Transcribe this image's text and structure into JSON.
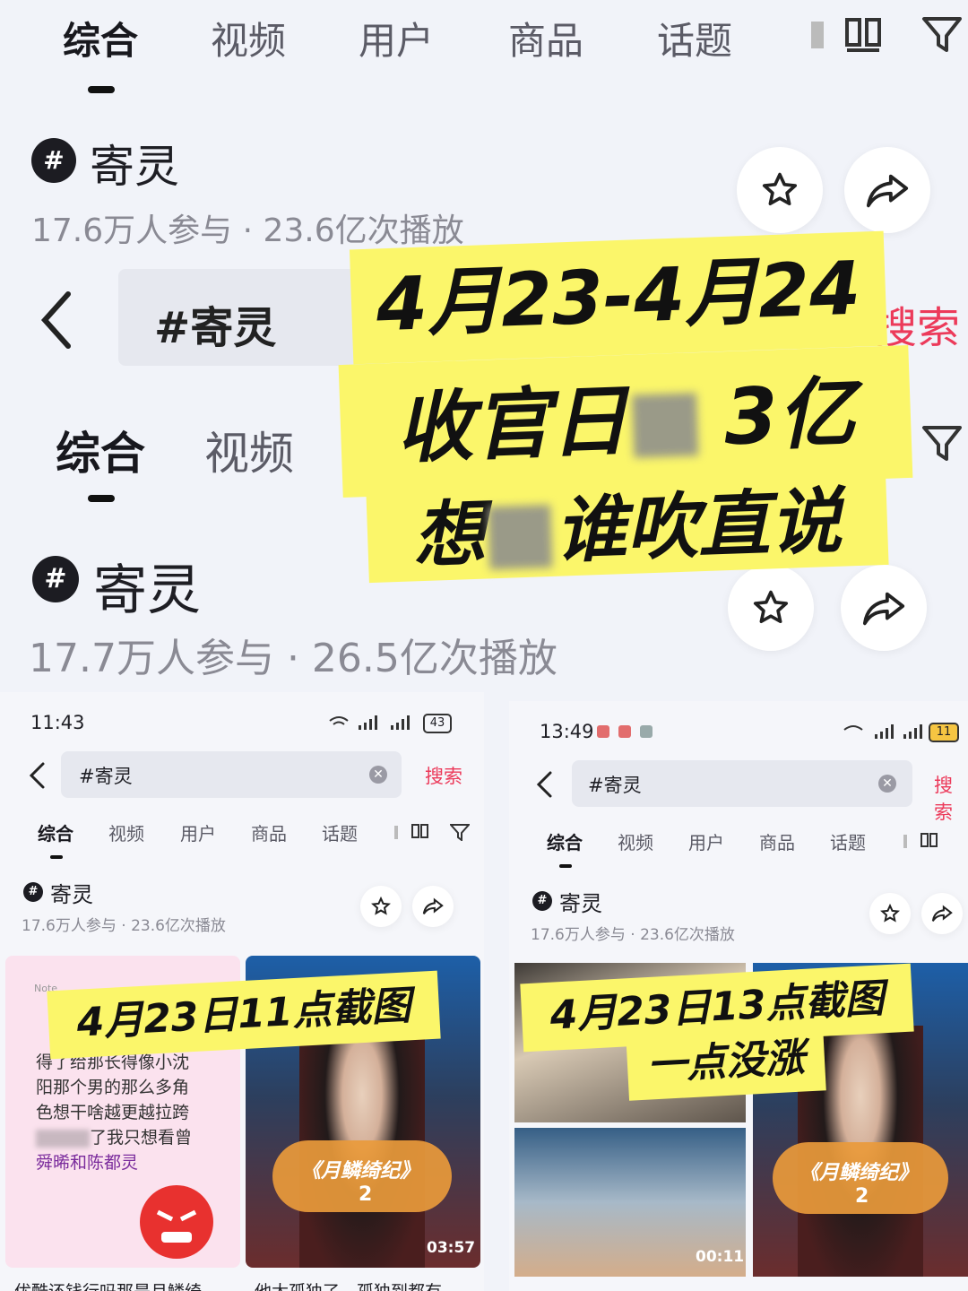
{
  "top": {
    "tabs": [
      "综合",
      "视频",
      "用户",
      "商品",
      "话题"
    ],
    "topic_title": "寄灵",
    "stats": "17.6万人参与 · 23.6亿次播放"
  },
  "search": {
    "query": "#寄灵",
    "button": "搜索"
  },
  "middle": {
    "tabs": [
      "综合",
      "视频"
    ],
    "topic_title": "寄灵",
    "stats": "17.7万人参与 · 26.5亿次播放"
  },
  "overlay_main": {
    "line1": "4月23-4月24",
    "line2": "收官日",
    "line2_end": "3亿",
    "line3_prefix": "想",
    "line3": "谁吹直说"
  },
  "left_shot": {
    "time": "11:43",
    "battery": "43",
    "query": "#寄灵",
    "search_btn": "搜索",
    "tabs": [
      "综合",
      "视频",
      "用户",
      "商品",
      "话题"
    ],
    "topic_title": "寄灵",
    "stats": "17.6万人参与 · 23.6亿次播放",
    "caption": "4月23日11点截图",
    "note_label": "Note",
    "note_lines": [
      "得了给那长得像小沈",
      "阳那个男的那么多角",
      "色想干啥越更越拉跨",
      "了我只想看曾",
      "舜晞和陈都灵"
    ],
    "poster_title": "《月鳞绮纪》",
    "poster_num": "2",
    "duration": "03:57",
    "bottom_left": "优酷还钱行吗那是月鳞绮",
    "bottom_right": "他太孤独了，孤独到都有"
  },
  "right_shot": {
    "time": "13:49",
    "battery": "11",
    "query": "#寄灵",
    "search_btn": "搜索",
    "tabs": [
      "综合",
      "视频",
      "用户",
      "商品",
      "话题"
    ],
    "topic_title": "寄灵",
    "stats": "17.6万人参与 · 23.6亿次播放",
    "caption_line1": "4月23日13点截图",
    "caption_line2": "一点没涨",
    "poster_title": "《月鳞绮纪》",
    "poster_num": "2",
    "duration": "00:11"
  },
  "colors": {
    "highlight": "#fbf66a",
    "search_red": "#ec3a5a",
    "background": "#f1f3f9"
  }
}
